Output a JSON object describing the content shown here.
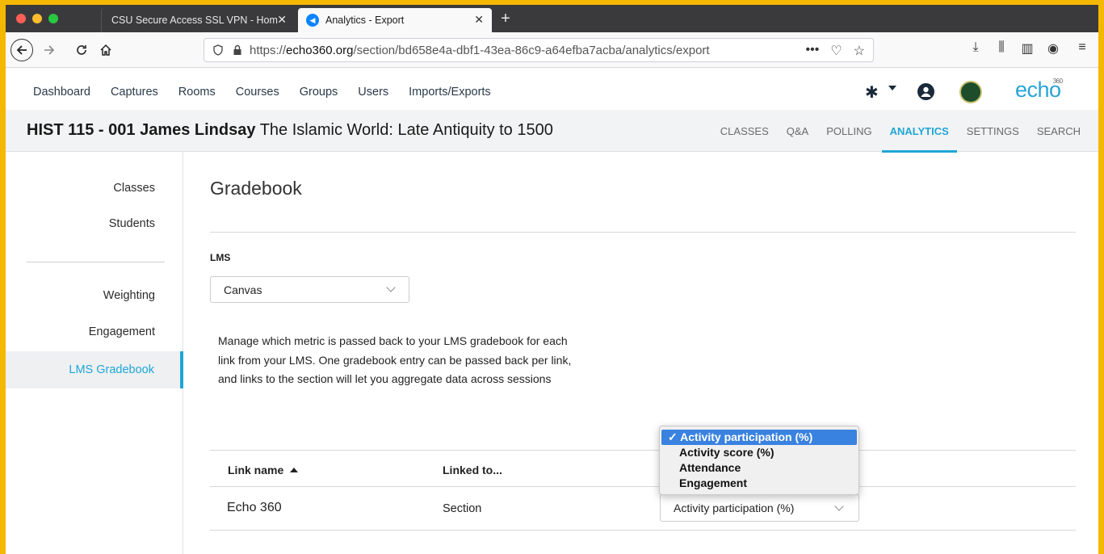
{
  "browser": {
    "tabs": [
      {
        "title": "CSU Secure Access SSL VPN - Hom",
        "active": false
      },
      {
        "title": "Analytics - Export",
        "active": true
      }
    ],
    "url_prefix": "https://",
    "url_domain": "echo360.org",
    "url_path": "/section/bd658e4a-dbf1-43ea-86c9-a64efba7acba/analytics/export"
  },
  "app": {
    "nav": [
      "Dashboard",
      "Captures",
      "Rooms",
      "Courses",
      "Groups",
      "Users",
      "Imports/Exports"
    ],
    "logo_text": "echo",
    "logo_sup": "360"
  },
  "course": {
    "code": "HIST 115 - 001 James Lindsay",
    "name": "The Islamic World: Late Antiquity to 1500",
    "tabs": [
      "CLASSES",
      "Q&A",
      "POLLING",
      "ANALYTICS",
      "SETTINGS",
      "SEARCH"
    ],
    "active_tab": "ANALYTICS"
  },
  "sidebar": {
    "items": [
      "Classes",
      "Students",
      "Weighting",
      "Engagement",
      "LMS Gradebook"
    ],
    "active": "LMS Gradebook"
  },
  "main": {
    "title": "Gradebook",
    "lms_label": "LMS",
    "lms_value": "Canvas",
    "description": "Manage which metric is passed back to your LMS gradebook for each link from your LMS. One gradebook entry can be passed back per link, and links to the section will let you aggregate data across sessions"
  },
  "table": {
    "headers": [
      "Link name",
      "Linked to..."
    ],
    "rows": [
      {
        "link_name": "Echo 360",
        "linked_to": "Section",
        "metric": "Activity participation (%)"
      }
    ]
  },
  "dropdown": {
    "options": [
      "Activity participation (%)",
      "Activity score (%)",
      "Attendance",
      "Engagement"
    ],
    "selected_index": 0,
    "check": "✓"
  },
  "colors": {
    "accent": "#1ea6d6",
    "border": "#f5b800",
    "highlight": "#3a82e0"
  }
}
